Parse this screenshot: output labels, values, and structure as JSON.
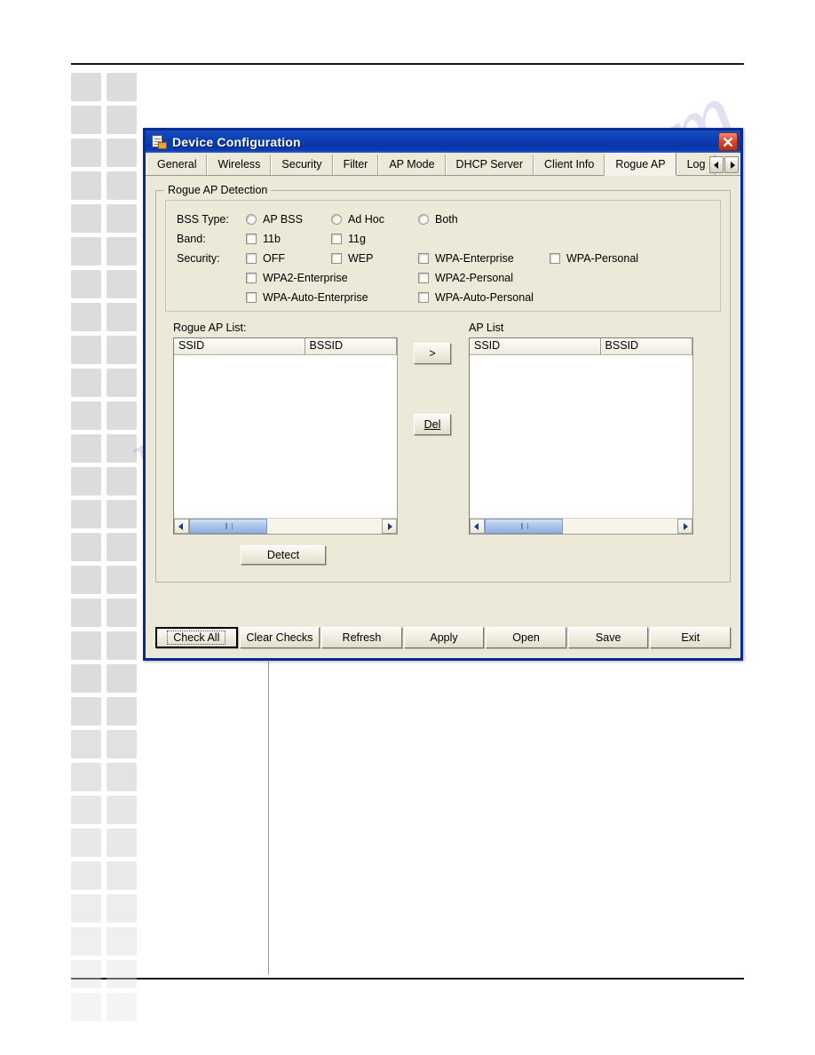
{
  "window": {
    "title": "Device Configuration",
    "icon": "device-config-icon",
    "close_label": "close-icon"
  },
  "tabs": [
    {
      "label": "General",
      "active": false
    },
    {
      "label": "Wireless",
      "active": false
    },
    {
      "label": "Security",
      "active": false
    },
    {
      "label": "Filter",
      "active": false
    },
    {
      "label": "AP Mode",
      "active": false
    },
    {
      "label": "DHCP Server",
      "active": false
    },
    {
      "label": "Client Info",
      "active": false
    },
    {
      "label": "Rogue AP",
      "active": true
    },
    {
      "label": "Log",
      "active": false
    }
  ],
  "tab_scroll": {
    "prev": "◀",
    "next": "▶"
  },
  "group": {
    "title": "Rogue AP Detection",
    "rows": {
      "bss_type_label": "BSS Type:",
      "band_label": "Band:",
      "security_label": "Security:"
    },
    "bss_type_options": [
      {
        "label": "AP BSS",
        "selected": false
      },
      {
        "label": "Ad Hoc",
        "selected": false
      },
      {
        "label": "Both",
        "selected": false
      }
    ],
    "band_options": [
      {
        "label": "11b",
        "checked": false
      },
      {
        "label": "11g",
        "checked": false
      }
    ],
    "security_options_row1": [
      {
        "label": "OFF",
        "checked": false
      },
      {
        "label": "WEP",
        "checked": false
      },
      {
        "label": "WPA-Enterprise",
        "checked": false
      },
      {
        "label": "WPA-Personal",
        "checked": false
      }
    ],
    "security_options_row2": [
      {
        "label": "WPA2-Enterprise",
        "checked": false
      },
      {
        "label": "WPA2-Personal",
        "checked": false
      }
    ],
    "security_options_row3": [
      {
        "label": "WPA-Auto-Enterprise",
        "checked": false
      },
      {
        "label": "WPA-Auto-Personal",
        "checked": false
      }
    ]
  },
  "lists": {
    "rogue": {
      "label": "Rogue AP List:",
      "columns": [
        "SSID",
        "BSSID"
      ],
      "rows": []
    },
    "ap": {
      "label": "AP List",
      "columns": [
        "SSID",
        "BSSID"
      ],
      "rows": []
    }
  },
  "mid_buttons": {
    "move_right": ">",
    "delete": "Del"
  },
  "detect_button": "Detect",
  "buttonbar": [
    {
      "label": "Check All",
      "default": true
    },
    {
      "label": "Clear Checks",
      "default": false
    },
    {
      "label": "Refresh",
      "default": false
    },
    {
      "label": "Apply",
      "default": false
    },
    {
      "label": "Open",
      "default": false
    },
    {
      "label": "Save",
      "default": false
    },
    {
      "label": "Exit",
      "default": false
    }
  ],
  "page": {
    "watermark": "manualshive.com"
  },
  "colors": {
    "title_bar": "#0c3fb4",
    "dialog_border": "#0a2a94",
    "dialog_face": "#ece9d8",
    "close_button": "#dc4a2e",
    "scroll_thumb": "#a8c2e8"
  }
}
